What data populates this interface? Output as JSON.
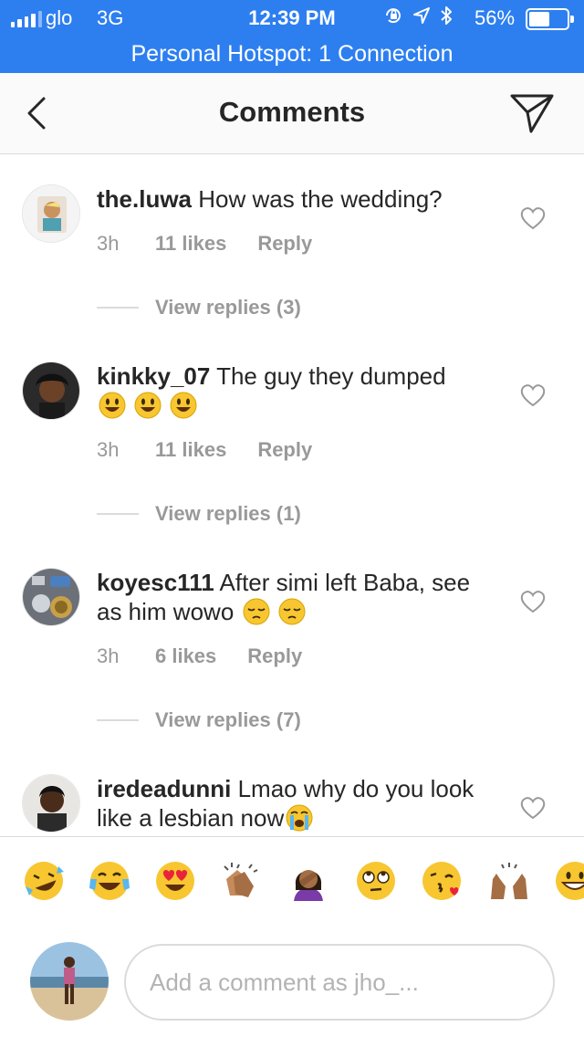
{
  "status_bar": {
    "carrier": "glo",
    "network": "3G",
    "time": "12:39 PM",
    "battery_percent": "56%",
    "battery_level": 0.56,
    "icons": [
      "orientation-lock-icon",
      "location-icon",
      "bluetooth-icon"
    ]
  },
  "hotspot": {
    "text": "Personal Hotspot: 1 Connection"
  },
  "header": {
    "title": "Comments"
  },
  "comments": [
    {
      "username": "the.luwa",
      "text": "How was the wedding?",
      "time": "3h",
      "likes": "11 likes",
      "reply": "Reply",
      "view_replies": "View replies (3)"
    },
    {
      "username": "kinkky_07",
      "text": "The guy they dumped",
      "emojis": [
        "smiley-emoji",
        "smiley-emoji",
        "smiley-emoji"
      ],
      "time": "3h",
      "likes": "11 likes",
      "reply": "Reply",
      "view_replies": "View replies (1)"
    },
    {
      "username": "koyesc111",
      "text": "After simi left Baba, see as him wowo",
      "emojis": [
        "pensive-emoji",
        "pensive-emoji"
      ],
      "time": "3h",
      "likes": "6 likes",
      "reply": "Reply",
      "view_replies": "View replies (7)"
    },
    {
      "username": "iredeadunni",
      "text": "Lmao why do you look like a lesbian now",
      "emojis": [
        "crying-emoji"
      ]
    }
  ],
  "quick_emojis": [
    "rofl-emoji",
    "joy-emoji",
    "heart-eyes-emoji",
    "clapping-emoji",
    "facepalm-emoji",
    "eye-roll-emoji",
    "kissing-heart-emoji",
    "raised-hands-emoji",
    "grinning-emoji"
  ],
  "composer": {
    "placeholder": "Add a comment as jho_..."
  },
  "colors": {
    "status_blue": "#2d7ff0",
    "secondary_text": "#999999",
    "divider": "#dbdbdb"
  }
}
